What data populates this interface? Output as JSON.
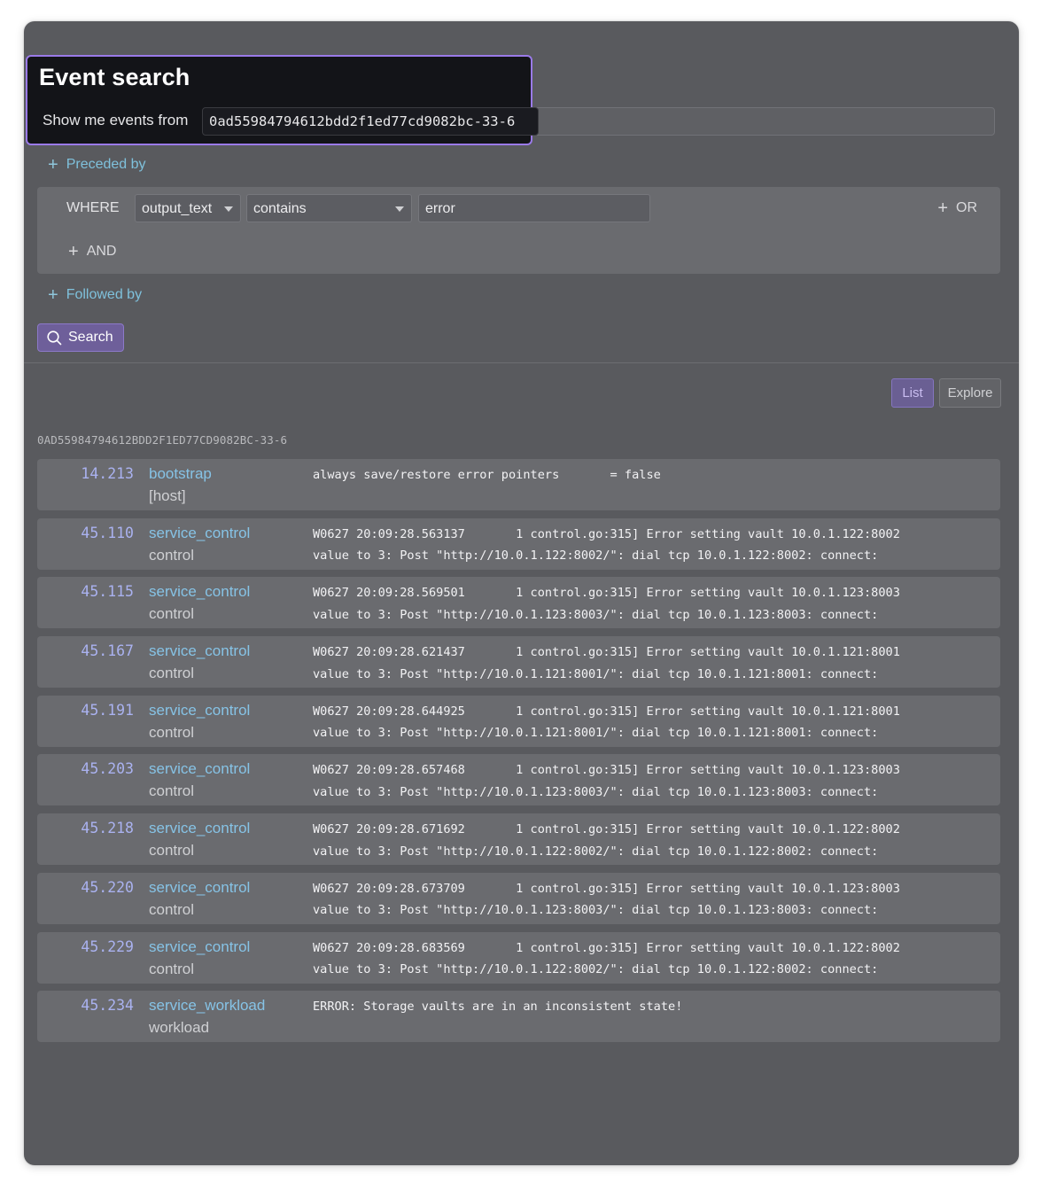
{
  "header": {
    "title": "Event search",
    "show_label": "Show me events from",
    "source_value": "0ad55984794612bdd2f1ed77cd9082bc-33-6"
  },
  "filters": {
    "preceded_by": "Preceded by",
    "followed_by": "Followed by",
    "where_label": "WHERE",
    "field": "output_text",
    "operator": "contains",
    "value": "error",
    "or_label": "OR",
    "and_label": "AND",
    "search_label": "Search"
  },
  "view_toggle": {
    "list": "List",
    "explore": "Explore",
    "selected": "List"
  },
  "results": {
    "group_id": "0AD55984794612BDD2F1ED77CD9082BC-33-6",
    "events": [
      {
        "time": "14.213",
        "service": "bootstrap",
        "sub": "[host]",
        "line1": "always save/restore error pointers       = false",
        "line2": ""
      },
      {
        "time": "45.110",
        "service": "service_control",
        "sub": "control",
        "line1": "W0627 20:09:28.563137       1 control.go:315] Error setting vault 10.0.1.122:8002",
        "line2": "value to 3: Post \"http://10.0.1.122:8002/\": dial tcp 10.0.1.122:8002: connect:"
      },
      {
        "time": "45.115",
        "service": "service_control",
        "sub": "control",
        "line1": "W0627 20:09:28.569501       1 control.go:315] Error setting vault 10.0.1.123:8003",
        "line2": "value to 3: Post \"http://10.0.1.123:8003/\": dial tcp 10.0.1.123:8003: connect:"
      },
      {
        "time": "45.167",
        "service": "service_control",
        "sub": "control",
        "line1": "W0627 20:09:28.621437       1 control.go:315] Error setting vault 10.0.1.121:8001",
        "line2": "value to 3: Post \"http://10.0.1.121:8001/\": dial tcp 10.0.1.121:8001: connect:"
      },
      {
        "time": "45.191",
        "service": "service_control",
        "sub": "control",
        "line1": "W0627 20:09:28.644925       1 control.go:315] Error setting vault 10.0.1.121:8001",
        "line2": "value to 3: Post \"http://10.0.1.121:8001/\": dial tcp 10.0.1.121:8001: connect:"
      },
      {
        "time": "45.203",
        "service": "service_control",
        "sub": "control",
        "line1": "W0627 20:09:28.657468       1 control.go:315] Error setting vault 10.0.1.123:8003",
        "line2": "value to 3: Post \"http://10.0.1.123:8003/\": dial tcp 10.0.1.123:8003: connect:"
      },
      {
        "time": "45.218",
        "service": "service_control",
        "sub": "control",
        "line1": "W0627 20:09:28.671692       1 control.go:315] Error setting vault 10.0.1.122:8002",
        "line2": "value to 3: Post \"http://10.0.1.122:8002/\": dial tcp 10.0.1.122:8002: connect:"
      },
      {
        "time": "45.220",
        "service": "service_control",
        "sub": "control",
        "line1": "W0627 20:09:28.673709       1 control.go:315] Error setting vault 10.0.1.123:8003",
        "line2": "value to 3: Post \"http://10.0.1.123:8003/\": dial tcp 10.0.1.123:8003: connect:"
      },
      {
        "time": "45.229",
        "service": "service_control",
        "sub": "control",
        "line1": "W0627 20:09:28.683569       1 control.go:315] Error setting vault 10.0.1.122:8002",
        "line2": "value to 3: Post \"http://10.0.1.122:8002/\": dial tcp 10.0.1.122:8002: connect:"
      },
      {
        "time": "45.234",
        "service": "service_workload",
        "sub": "workload",
        "line1": "ERROR: Storage vaults are in an inconsistent state!",
        "line2": ""
      }
    ]
  },
  "colors": {
    "accent": "#9a7ae8",
    "link": "#7fc1dc",
    "timestamp": "#aab2f0",
    "service": "#86c3e6"
  }
}
